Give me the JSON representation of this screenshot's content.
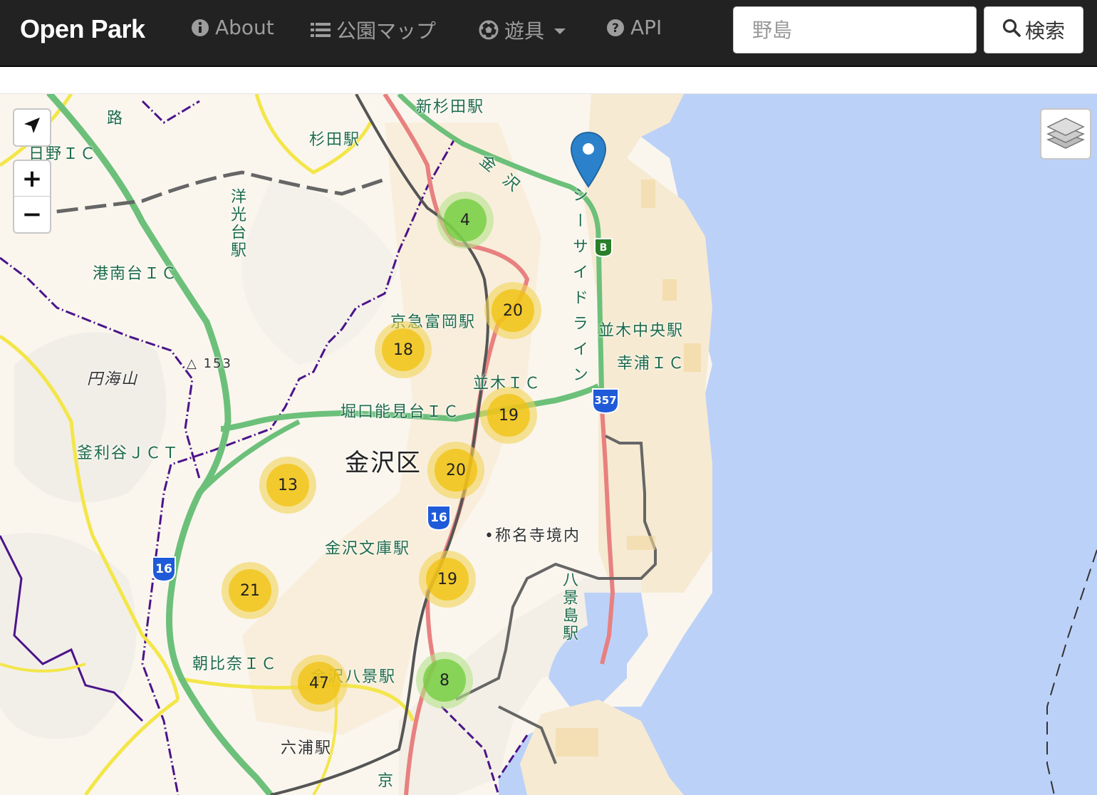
{
  "navbar": {
    "brand": "Open Park",
    "items": [
      {
        "label": "About",
        "icon": "info-icon"
      },
      {
        "label": "公園マップ",
        "icon": "list-icon"
      },
      {
        "label": "遊具",
        "icon": "soccer-ball-icon",
        "dropdown": true
      },
      {
        "label": "API",
        "icon": "question-icon"
      }
    ],
    "search": {
      "value": "",
      "placeholder": "野島"
    },
    "search_button": "検索"
  },
  "map_controls": {
    "zoom_in": "+",
    "zoom_out": "−"
  },
  "clusters": [
    {
      "count": "4",
      "color": "green"
    },
    {
      "count": "20",
      "color": "yellow"
    },
    {
      "count": "18",
      "color": "yellow"
    },
    {
      "count": "19",
      "color": "yellow"
    },
    {
      "count": "20",
      "color": "yellow"
    },
    {
      "count": "13",
      "color": "yellow"
    },
    {
      "count": "19",
      "color": "yellow"
    },
    {
      "count": "21",
      "color": "yellow"
    },
    {
      "count": "47",
      "color": "yellow"
    },
    {
      "count": "8",
      "color": "green"
    }
  ],
  "map_labels": {
    "shin_sugita": "新杉田駅",
    "sugita": "杉田駅",
    "hino_ic": "日野ＩＣ",
    "yokodai": "洋光台駅",
    "konandai_ic": "港南台ＩＣ",
    "keikyu_tomioka": "京急富岡駅",
    "namiki_chuo": "並木中央駅",
    "sachiura_ic": "幸浦ＩＣ",
    "namiki_ic": "並木ＩＣ",
    "horiguchi_ic": "堀口能見台ＩＣ",
    "enkaizan": "円海山",
    "elev": "△ 153",
    "kamariya_jct": "釜利谷ＪＣＴ",
    "kanazawa_ku": "金沢区",
    "shomyoji": "•称名寺境内",
    "kanazawa_bunko": "金沢文庫駅",
    "hakkeijima": "八景島駅",
    "asahina_ic": "朝比奈ＩＣ",
    "kanazawa_hakkei": "金沢八景駅",
    "mutsuura": "六浦駅",
    "seaside_line": "シーサイドライン",
    "kanazawa": "金沢",
    "route16a": "16",
    "route16b": "16",
    "route357": "357",
    "route_b": "B",
    "kei": "京",
    "ro": "路"
  },
  "colors": {
    "navbar_bg": "#222222",
    "sea": "#bcd1f8",
    "land": "#faf6ee",
    "expressway": "#6cc07a",
    "national_road": "#e88080",
    "prefectural_road": "#f3e64a",
    "railway": "#555555",
    "boundary": "#4b148a"
  }
}
